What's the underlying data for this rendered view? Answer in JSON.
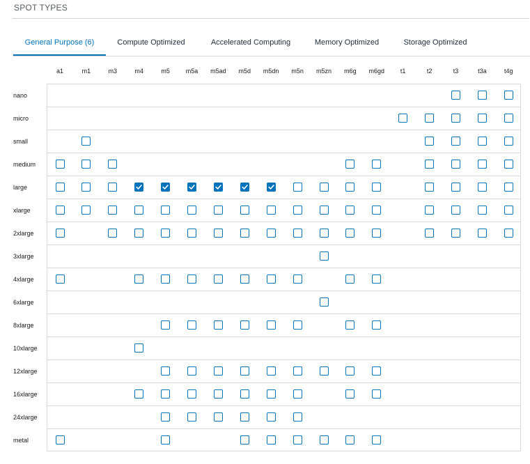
{
  "section_title": "SPOT TYPES",
  "tabs": [
    {
      "label": "General Purpose (6)",
      "active": true
    },
    {
      "label": "Compute Optimized",
      "active": false
    },
    {
      "label": "Accelerated Computing",
      "active": false
    },
    {
      "label": "Memory Optimized",
      "active": false
    },
    {
      "label": "Storage Optimized",
      "active": false
    }
  ],
  "colors": {
    "accent": "#0073bb",
    "border": "#d5dbdb"
  },
  "families": [
    "a1",
    "m1",
    "m3",
    "m4",
    "m5",
    "m5a",
    "m5ad",
    "m5d",
    "m5dn",
    "m5n",
    "m5zn",
    "m6g",
    "m6gd",
    "t1",
    "t2",
    "t3",
    "t3a",
    "t4g"
  ],
  "sizes": [
    "nano",
    "micro",
    "small",
    "medium",
    "large",
    "xlarge",
    "2xlarge",
    "3xlarge",
    "4xlarge",
    "6xlarge",
    "8xlarge",
    "10xlarge",
    "12xlarge",
    "16xlarge",
    "24xlarge",
    "metal"
  ],
  "available": {
    "nano": [
      "t3",
      "t3a",
      "t4g"
    ],
    "micro": [
      "t1",
      "t2",
      "t3",
      "t3a",
      "t4g"
    ],
    "small": [
      "m1",
      "t2",
      "t3",
      "t3a",
      "t4g"
    ],
    "medium": [
      "a1",
      "m1",
      "m3",
      "m6g",
      "m6gd",
      "t2",
      "t3",
      "t3a",
      "t4g"
    ],
    "large": [
      "a1",
      "m1",
      "m3",
      "m4",
      "m5",
      "m5a",
      "m5ad",
      "m5d",
      "m5dn",
      "m5n",
      "m5zn",
      "m6g",
      "m6gd",
      "t2",
      "t3",
      "t3a",
      "t4g"
    ],
    "xlarge": [
      "a1",
      "m1",
      "m3",
      "m4",
      "m5",
      "m5a",
      "m5ad",
      "m5d",
      "m5dn",
      "m5n",
      "m5zn",
      "m6g",
      "m6gd",
      "t2",
      "t3",
      "t3a",
      "t4g"
    ],
    "2xlarge": [
      "a1",
      "m3",
      "m4",
      "m5",
      "m5a",
      "m5ad",
      "m5d",
      "m5dn",
      "m5n",
      "m5zn",
      "m6g",
      "m6gd",
      "t2",
      "t3",
      "t3a",
      "t4g"
    ],
    "3xlarge": [
      "m5zn"
    ],
    "4xlarge": [
      "a1",
      "m4",
      "m5",
      "m5a",
      "m5ad",
      "m5d",
      "m5dn",
      "m5n",
      "m6g",
      "m6gd"
    ],
    "6xlarge": [
      "m5zn"
    ],
    "8xlarge": [
      "m5",
      "m5a",
      "m5ad",
      "m5d",
      "m5dn",
      "m5n",
      "m6g",
      "m6gd"
    ],
    "10xlarge": [
      "m4"
    ],
    "12xlarge": [
      "m5",
      "m5a",
      "m5ad",
      "m5d",
      "m5dn",
      "m5n",
      "m5zn",
      "m6g",
      "m6gd"
    ],
    "16xlarge": [
      "m4",
      "m5",
      "m5a",
      "m5ad",
      "m5d",
      "m5dn",
      "m5n",
      "m6g",
      "m6gd"
    ],
    "24xlarge": [
      "m5",
      "m5a",
      "m5ad",
      "m5d",
      "m5dn",
      "m5n"
    ],
    "metal": [
      "a1",
      "m5",
      "m5d",
      "m5dn",
      "m5n",
      "m5zn",
      "m6g",
      "m6gd"
    ]
  },
  "checked": {
    "large": [
      "m4",
      "m5",
      "m5a",
      "m5ad",
      "m5d",
      "m5dn"
    ]
  }
}
